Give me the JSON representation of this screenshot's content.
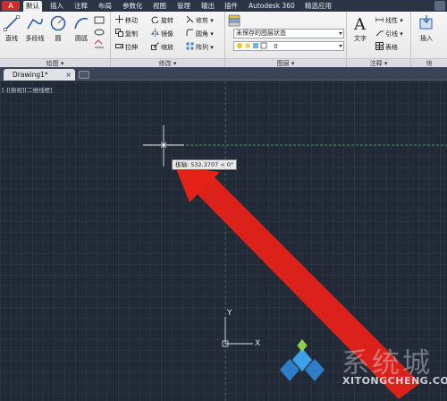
{
  "ribbon": {
    "app_button": "A",
    "tabs": [
      "默认",
      "插入",
      "注释",
      "布局",
      "参数化",
      "视图",
      "管理",
      "输出",
      "插件",
      "Autodesk 360",
      "精选应用"
    ],
    "active_tab": 0
  },
  "panels": {
    "draw": {
      "title": "绘图 ▾",
      "tools": [
        "直线",
        "多段线",
        "圆",
        "圆弧"
      ]
    },
    "modify": {
      "title": "修改 ▾",
      "rows": [
        [
          "移动",
          "旋转",
          "修剪 ▾"
        ],
        [
          "复制",
          "镜像",
          "圆角 ▾"
        ],
        [
          "拉伸",
          "缩放",
          "阵列 ▾"
        ]
      ]
    },
    "layers": {
      "title": "图层 ▾",
      "state_combo": "未保存的图层状态",
      "layer_combo": "0"
    },
    "annotation": {
      "title": "注释 ▾",
      "text": "文字",
      "items": [
        "线性 ▾",
        "引线 ▾",
        "表格"
      ]
    },
    "block": {
      "title": "块",
      "insert": "插入"
    }
  },
  "document": {
    "tab_label": "Drawing1*",
    "close_glyph": "×",
    "viewport_label": "[-][俯视][二维线框]"
  },
  "tooltip": {
    "text": "极轴: 532.3707 < 0°"
  },
  "ucs": {
    "y_label": "Y",
    "x_label": "X"
  },
  "watermark": {
    "name": "系统城",
    "site": "XITONGCHENG.COM"
  },
  "colors": {
    "canvas_bg": "#222a37",
    "polar_tracking": "#2e9e55",
    "annotation_arrow": "#e62117",
    "ribbon_bg": "#eeeeee"
  }
}
